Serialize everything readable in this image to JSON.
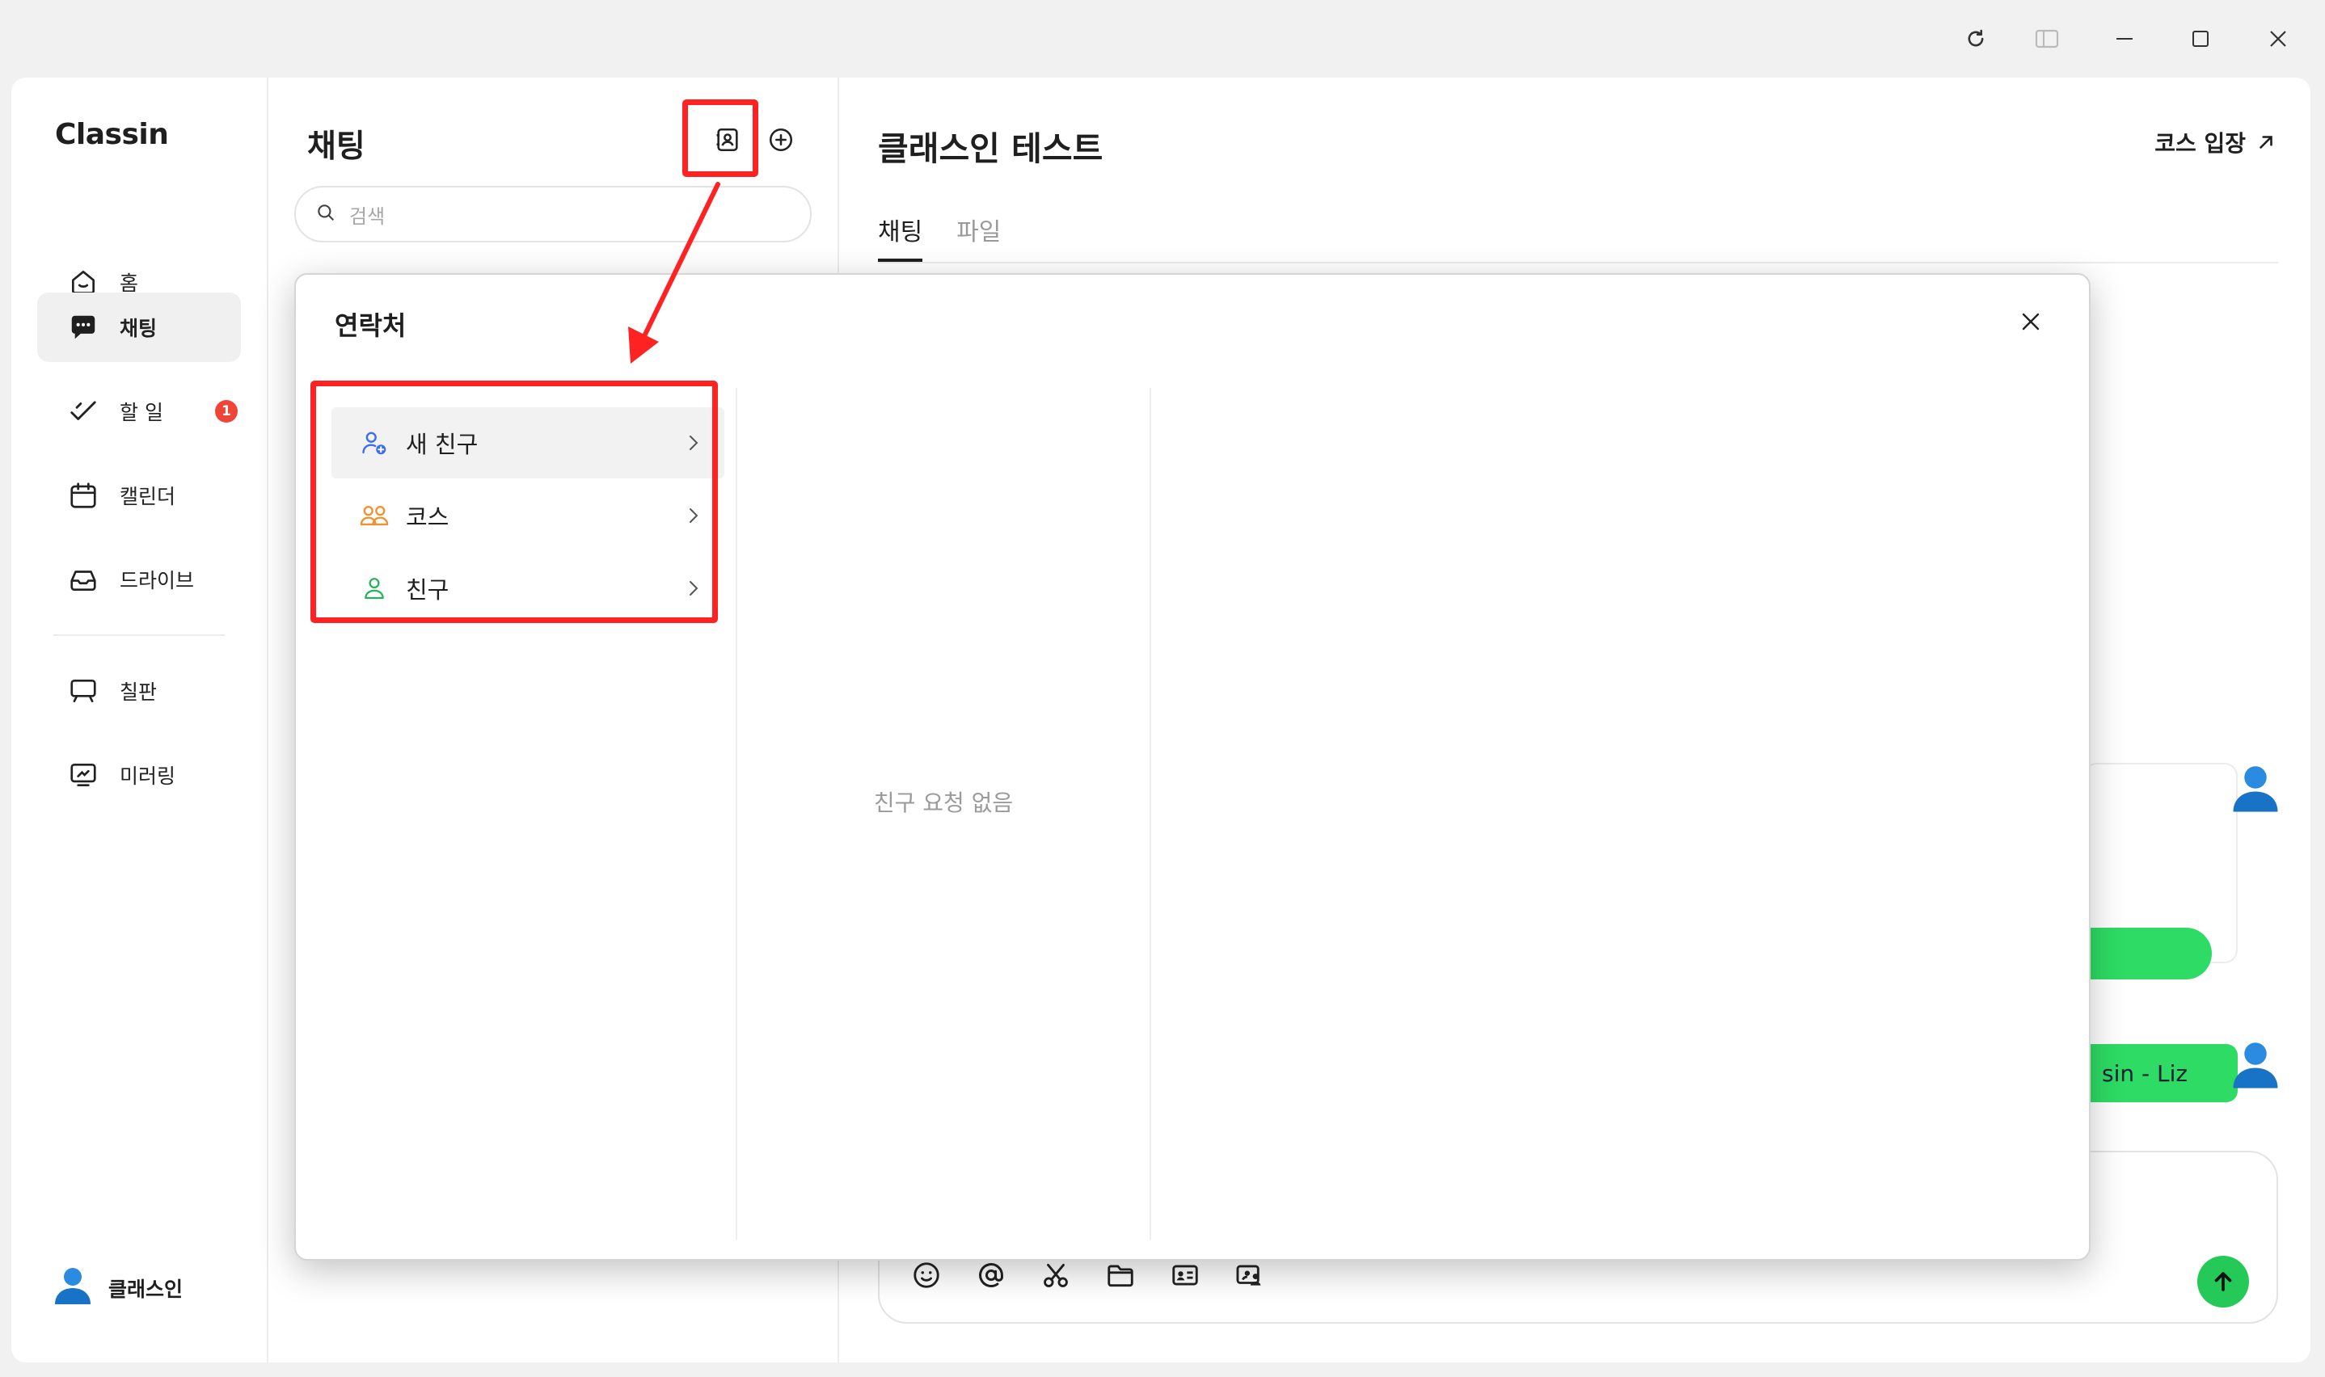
{
  "window": {
    "controls": [
      "refresh-icon",
      "sidebar-toggle-icon",
      "minimize-icon",
      "maximize-icon",
      "close-icon"
    ]
  },
  "sidebar": {
    "logo": "Classin",
    "items": [
      {
        "label": "홈",
        "icon": "home-icon"
      },
      {
        "label": "채팅",
        "icon": "chat-icon",
        "active": true
      },
      {
        "label": "할 일",
        "icon": "todo-icon",
        "badge": "1"
      },
      {
        "label": "캘린더",
        "icon": "calendar-icon"
      },
      {
        "label": "드라이브",
        "icon": "drive-icon"
      },
      {
        "label": "칠판",
        "icon": "blackboard-icon"
      },
      {
        "label": "미러링",
        "icon": "mirroring-icon"
      }
    ],
    "profile": {
      "name": "클래스인"
    }
  },
  "chatlist": {
    "title": "채팅",
    "search_placeholder": "검색"
  },
  "main": {
    "title": "클래스인 테스트",
    "enter_course": "코스 입장",
    "tabs": [
      {
        "label": "채팅",
        "active": true
      },
      {
        "label": "파일"
      }
    ],
    "message_text": "sin - Liz"
  },
  "modal": {
    "title": "연락처",
    "rows": [
      {
        "label": "새 친구",
        "icon": "add-friend-icon",
        "color": "#3b6df2"
      },
      {
        "label": "코스",
        "icon": "course-group-icon",
        "color": "#f0902e"
      },
      {
        "label": "친구",
        "icon": "friend-icon",
        "color": "#24b25a"
      }
    ],
    "empty_text": "친구 요청 없음"
  },
  "colors": {
    "accent_green": "#2edb64",
    "highlight_red": "#ff2222",
    "badge_red": "#f04438",
    "avatar_blue": "#2a8be0"
  }
}
